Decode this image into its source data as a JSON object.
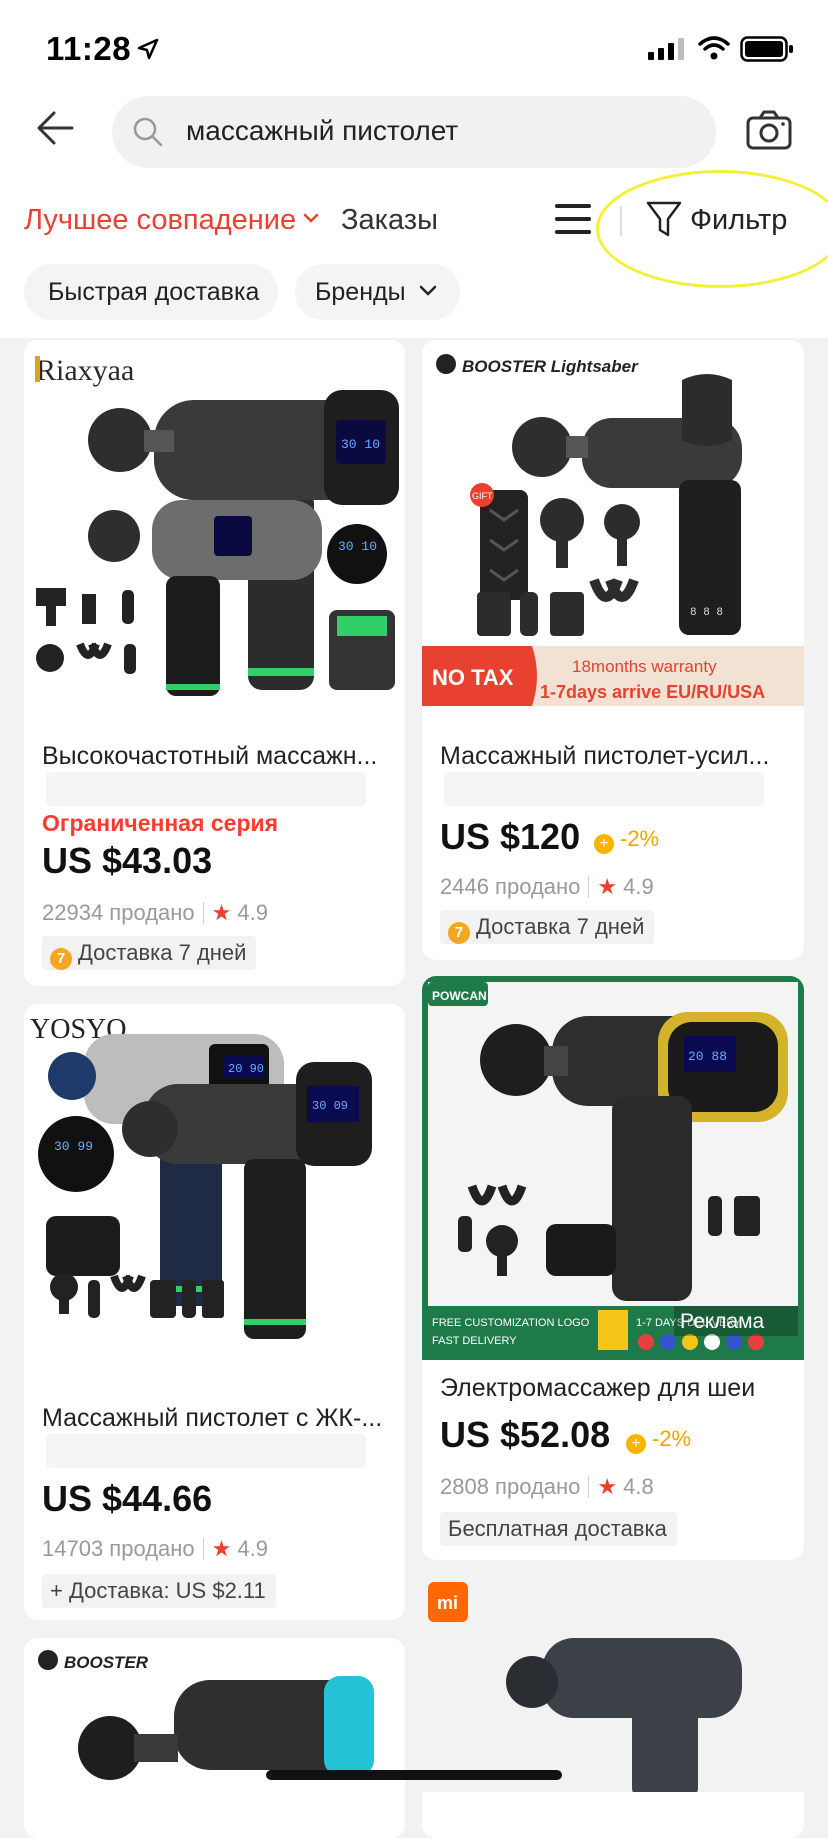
{
  "status": {
    "time": "11:28"
  },
  "search": {
    "query": "массажный пистолет"
  },
  "sort": {
    "best_match": "Лучшее совпадение",
    "orders": "Заказы",
    "filter": "Фильтр"
  },
  "chips": [
    "Быстрая доставка",
    "Бренды"
  ],
  "products": [
    {
      "brand": "Riaxyaa",
      "title": "Высокочастотный массажн...",
      "badge": "Ограниченная серия",
      "price": "US $43.03",
      "sold": "22934 продано",
      "rating": "4.9",
      "delivery": "Доставка 7 дней",
      "lcd1": "30 10",
      "lcd2": "30 10"
    },
    {
      "brand": "BOOSTER Lightsaber",
      "title": "Массажный пистолет-усил...",
      "price": "US $120",
      "discount": "-2%",
      "sold": "2446 продано",
      "rating": "4.9",
      "delivery": "Доставка 7 дней",
      "banner_left": "NO TAX",
      "banner_line1": "18months warranty",
      "banner_line2": "1-7days arrive EU/RU/USA",
      "gift": "GIFT"
    },
    {
      "brand": "YOSYO",
      "title": "Массажный пистолет с ЖК-...",
      "price": "US $44.66",
      "sold": "14703 продано",
      "rating": "4.9",
      "delivery": "+ Доставка: US $2.11",
      "lcd1": "20 90",
      "lcd2": "30 09",
      "lcd3": "30 99"
    },
    {
      "brand": "POWCAN",
      "title": "Электромассажер для шеи",
      "price": "US $52.08",
      "discount": "-2%",
      "sold": "2808 продано",
      "rating": "4.8",
      "delivery": "Бесплатная доставка",
      "ad": "Реклама",
      "footer1": "FREE CUSTOMIZATION LOGO",
      "footer2": "FAST DELIVERY",
      "footer3": "1-7 DAYS DELIVERY",
      "lcd": "20 88"
    },
    {
      "brand": "BOOSTER"
    },
    {
      "brand": "mi"
    }
  ]
}
